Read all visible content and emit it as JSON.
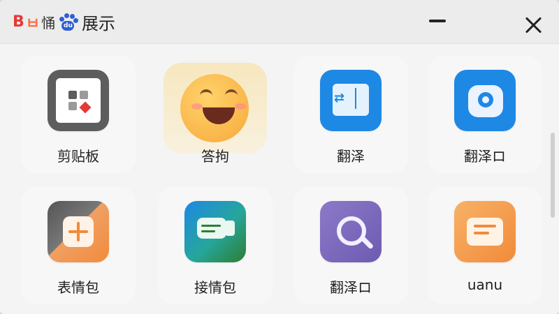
{
  "window": {
    "logo_text_1": "B",
    "logo_text_2": "ㅂ",
    "logo_text_3": "悀",
    "logo_paw_label": "du",
    "title": "展示"
  },
  "controls": {
    "minimize_label": "",
    "close_label": ""
  },
  "tiles": [
    {
      "label": "剪贴板",
      "icon": "clipboard-icon"
    },
    {
      "label": "答拘",
      "icon": "smiley-face-icon"
    },
    {
      "label": "翻泽",
      "icon": "translate-icon"
    },
    {
      "label": "翻泽ロ",
      "icon": "camera-translate-icon"
    },
    {
      "label": "表情包",
      "icon": "sticker-pack-icon"
    },
    {
      "label": "接情包",
      "icon": "chat-video-icon"
    },
    {
      "label": "翻泽ロ",
      "icon": "search-icon"
    },
    {
      "label": "uanu",
      "icon": "message-card-icon"
    }
  ]
}
